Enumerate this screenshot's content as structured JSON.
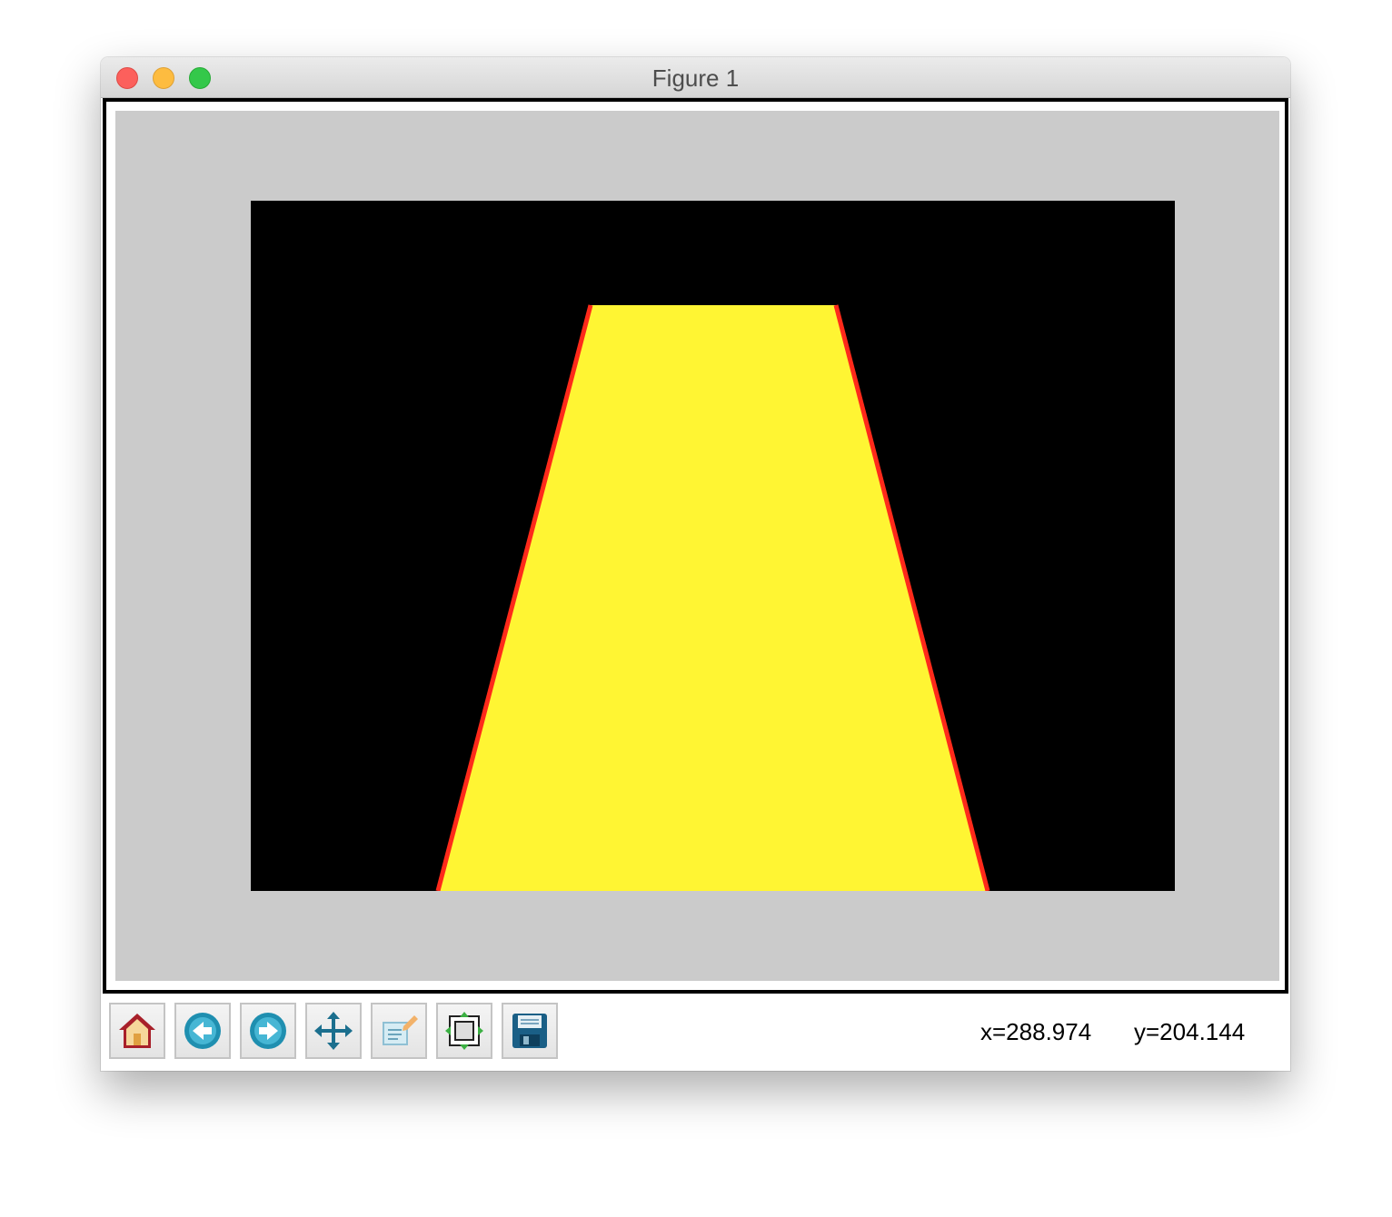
{
  "window": {
    "title": "Figure 1"
  },
  "figure": {
    "figure_background": "#cbcbcb",
    "axes_background": "#000000",
    "fill_color": "#fff533",
    "edge_color": "#ff2a1a"
  },
  "toolbar": {
    "buttons": [
      {
        "icon": "home-icon"
      },
      {
        "icon": "back-arrow-icon"
      },
      {
        "icon": "forward-arrow-icon"
      },
      {
        "icon": "pan-move-icon"
      },
      {
        "icon": "zoom-to-rect-icon"
      },
      {
        "icon": "subplots-configure-icon"
      },
      {
        "icon": "save-disk-icon"
      }
    ],
    "x_readout": "x=288.974",
    "y_readout": "y=204.144"
  }
}
